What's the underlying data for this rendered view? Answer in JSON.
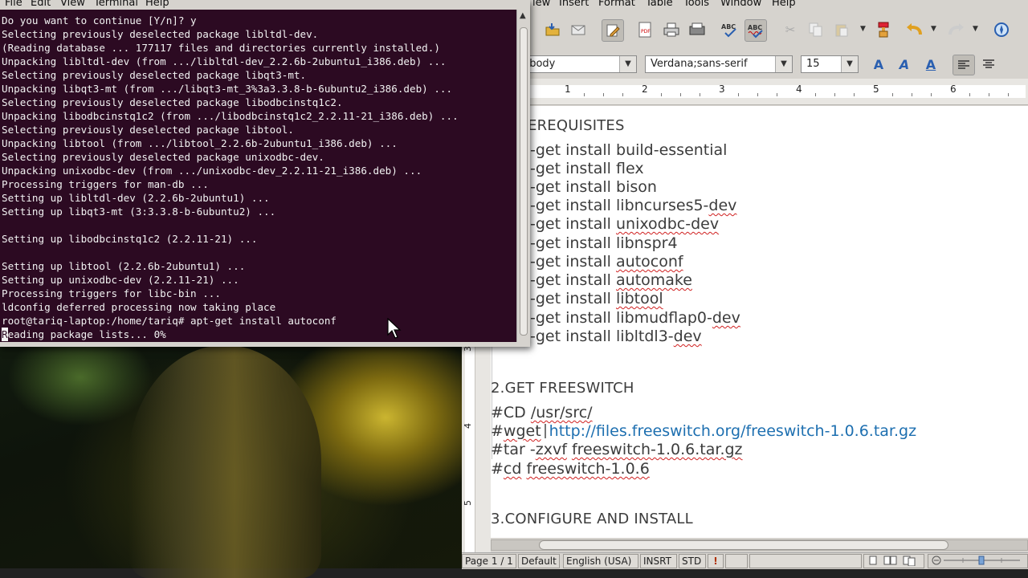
{
  "terminal": {
    "menu": [
      "File",
      "Edit",
      "View",
      "Terminal",
      "Help"
    ],
    "lines": [
      "Do you want to continue [Y/n]? y",
      "Selecting previously deselected package libltdl-dev.",
      "(Reading database ... 177117 files and directories currently installed.)",
      "Unpacking libltdl-dev (from .../libltdl-dev_2.2.6b-2ubuntu1_i386.deb) ...",
      "Selecting previously deselected package libqt3-mt.",
      "Unpacking libqt3-mt (from .../libqt3-mt_3%3a3.3.8-b-6ubuntu2_i386.deb) ...",
      "Selecting previously deselected package libodbcinstq1c2.",
      "Unpacking libodbcinstq1c2 (from .../libodbcinstq1c2_2.2.11-21_i386.deb) ...",
      "Selecting previously deselected package libtool.",
      "Unpacking libtool (from .../libtool_2.2.6b-2ubuntu1_i386.deb) ...",
      "Selecting previously deselected package unixodbc-dev.",
      "Unpacking unixodbc-dev (from .../unixodbc-dev_2.2.11-21_i386.deb) ...",
      "Processing triggers for man-db ...",
      "Setting up libltdl-dev (2.2.6b-2ubuntu1) ...",
      "Setting up libqt3-mt (3:3.3.8-b-6ubuntu2) ...",
      "",
      "Setting up libodbcinstq1c2 (2.2.11-21) ...",
      "",
      "Setting up libtool (2.2.6b-2ubuntu1) ...",
      "Setting up unixodbc-dev (2.2.11-21) ...",
      "Processing triggers for libc-bin ...",
      "ldconfig deferred processing now taking place",
      "root@tariq-laptop:/home/tariq# apt-get install autoconf"
    ],
    "last_line_cursor_char": "R",
    "last_line_rest": "eading package lists... 0%"
  },
  "writer": {
    "menu": [
      "iew",
      "Insert",
      "Format",
      "Table",
      "Tools",
      "Window",
      "Help"
    ],
    "toolbar": {
      "icons": [
        "open-icon",
        "email-icon",
        "edit-mode-icon",
        "export-pdf-icon",
        "print-icon",
        "print-preview-icon",
        "spellcheck-icon",
        "autospellcheck-icon",
        "cut-icon",
        "copy-icon",
        "paste-icon",
        "clone-format-icon",
        "undo-icon",
        "redo-icon",
        "navigator-icon"
      ]
    },
    "format": {
      "style": "t body",
      "font": "Verdana;sans-serif",
      "size": "15"
    },
    "ruler_numbers": [
      "1",
      "2",
      "3",
      "4",
      "5",
      "6"
    ],
    "vruler_numbers": [
      "3",
      "4",
      "5"
    ],
    "doc": {
      "prereq_heading": "EREQUISITES",
      "prereq_items": [
        {
          "prefix": "-get install ",
          "pkg": "build-essential",
          "squiggle": false,
          "tail": ""
        },
        {
          "prefix": "-get install ",
          "pkg": "flex",
          "squiggle": false,
          "tail": ""
        },
        {
          "prefix": "-get install ",
          "pkg": "bison",
          "squiggle": false,
          "tail": ""
        },
        {
          "prefix": "-get install ",
          "pkg": "libncurses5-",
          "squiggle": false,
          "tail": "dev"
        },
        {
          "prefix": "-get install ",
          "pkg": "unixodbc-dev",
          "squiggle": true,
          "tail": ""
        },
        {
          "prefix": "-get install ",
          "pkg": "libnspr4",
          "squiggle": false,
          "tail": ""
        },
        {
          "prefix": "-get install ",
          "pkg": "autoconf",
          "squiggle": true,
          "tail": ""
        },
        {
          "prefix": "-get install ",
          "pkg": "automake",
          "squiggle": true,
          "tail": ""
        },
        {
          "prefix": "-get install ",
          "pkg": "libtool",
          "squiggle": true,
          "tail": ""
        },
        {
          "prefix": "-get install ",
          "pkg": "libmudflap0-",
          "squiggle": false,
          "tail": "dev"
        },
        {
          "prefix": "-get install ",
          "pkg": "libltdl3-",
          "squiggle": false,
          "tail": "dev"
        }
      ],
      "get_heading": "2.GET FREESWITCH",
      "cd_hash": "#CD ",
      "cd_path": "/usr/src/",
      "wget_hash": "#",
      "wget_cmd": "wget",
      "wget_url": "http://files.freeswitch.org/freeswitch-1.0.6.tar.gz",
      "tar_cmd": "#tar -",
      "tar_flags": "zxvf",
      "tar_file": "freeswitch-1.0.6.tar.gz",
      "cd2_hash": "#",
      "cd2_cmd": "cd",
      "cd2_dir": "freeswitch-1.0.6",
      "configure_heading": "3.CONFIGURE AND INSTALL"
    },
    "status": {
      "page": "Page 1 / 1",
      "style": "Default",
      "language": "English (USA)",
      "insert_mode": "INSRT",
      "selection_mode": "STD",
      "modified": "!"
    },
    "colors": {
      "terminal_bg": "#2c0a22",
      "link": "#1d6fb0",
      "spell_error": "#d02020"
    }
  }
}
